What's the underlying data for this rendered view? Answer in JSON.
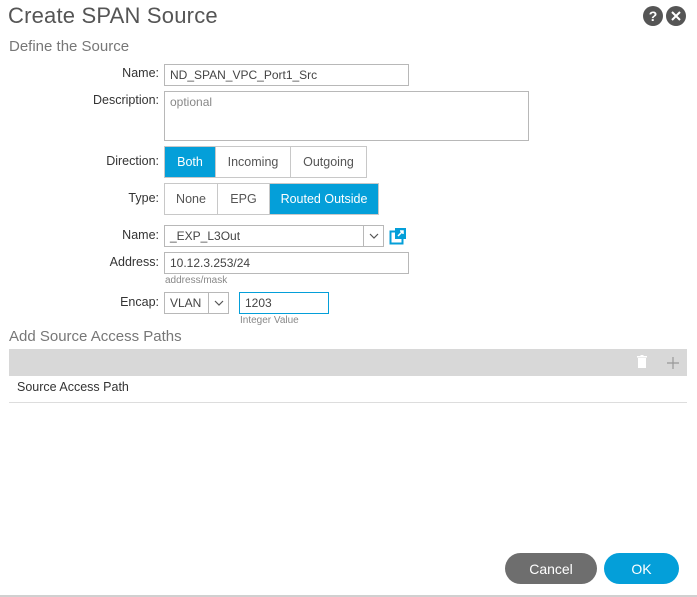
{
  "dialog": {
    "title": "Create SPAN Source",
    "subtitle": "Define the Source"
  },
  "form": {
    "name_label": "Name:",
    "name_value": "ND_SPAN_VPC_Port1_Src",
    "description_label": "Description:",
    "description_placeholder": "optional",
    "direction_label": "Direction:",
    "direction_options": [
      "Both",
      "Incoming",
      "Outgoing"
    ],
    "direction_selected": "Both",
    "type_label": "Type:",
    "type_options": [
      "None",
      "EPG",
      "Routed Outside"
    ],
    "type_selected": "Routed Outside",
    "l3out_name_label": "Name:",
    "l3out_name_value": "_EXP_L3Out",
    "address_label": "Address:",
    "address_value": "10.12.3.253/24",
    "address_hint": "address/mask",
    "encap_label": "Encap:",
    "encap_type": "VLAN",
    "encap_value": "1203",
    "encap_hint": "Integer Value"
  },
  "paths": {
    "section_title": "Add Source Access Paths",
    "column_header": "Source Access Path"
  },
  "footer": {
    "cancel_label": "Cancel",
    "ok_label": "OK"
  },
  "colors": {
    "accent": "#049fd9",
    "cancel": "#6e6e6e"
  }
}
